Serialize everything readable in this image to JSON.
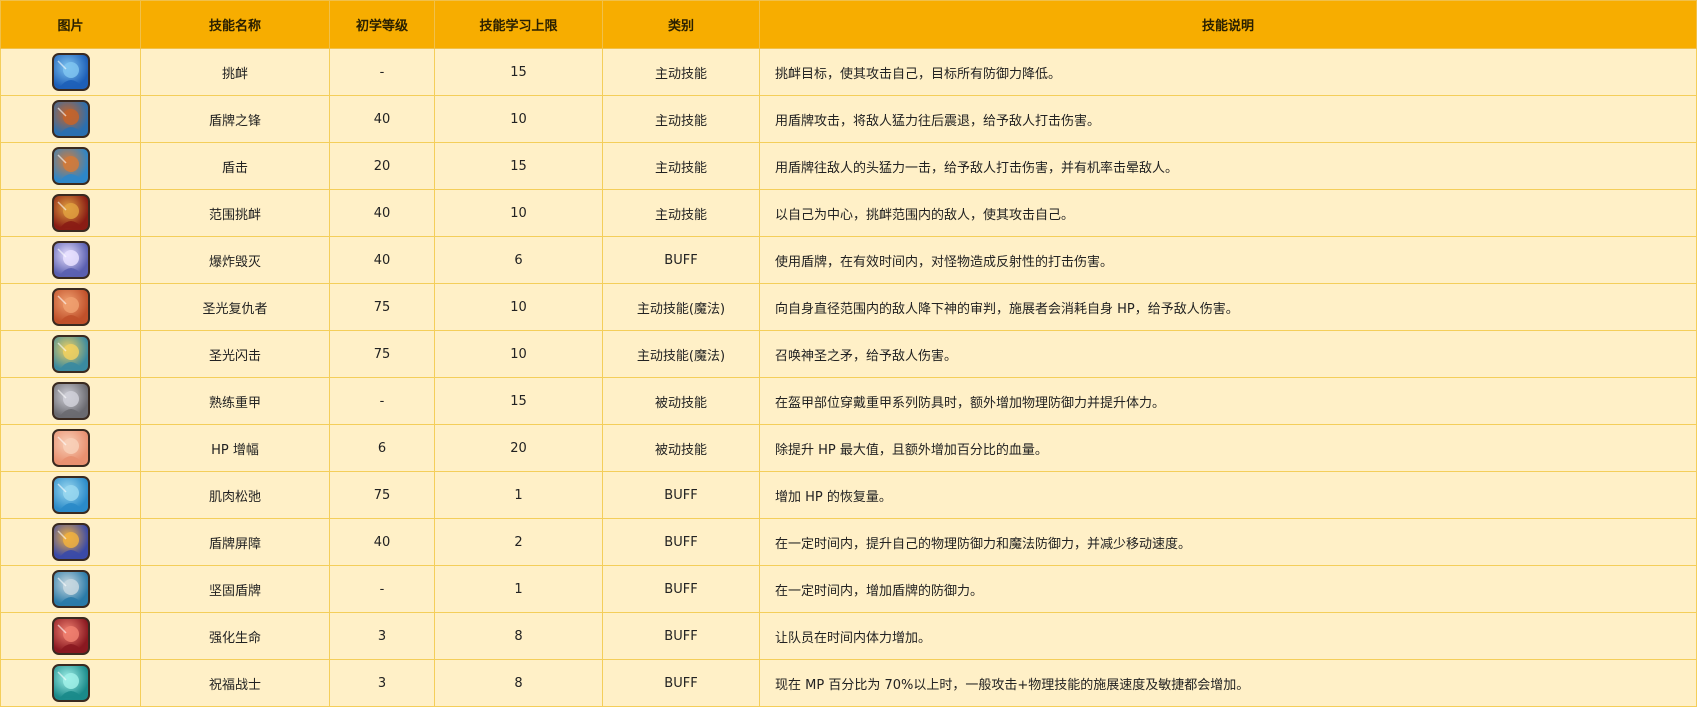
{
  "table": {
    "headers": {
      "image": "图片",
      "name": "技能名称",
      "level": "初学等级",
      "max": "技能学习上限",
      "category": "类别",
      "description": "技能说明"
    },
    "rows": [
      {
        "icon": "taunt-mask-icon",
        "colors": [
          "#1d5fb8",
          "#7fc4f0"
        ],
        "name": "挑衅",
        "level": "-",
        "max": "15",
        "category": "主动技能",
        "description": "挑衅目标，使其攻击自己，目标所有防御力降低。"
      },
      {
        "icon": "shield-edge-icon",
        "colors": [
          "#2a6fb0",
          "#c5642a"
        ],
        "name": "盾牌之锋",
        "level": "40",
        "max": "10",
        "category": "主动技能",
        "description": "用盾牌攻击，将敌人猛力往后震退，给予敌人打击伤害。"
      },
      {
        "icon": "shield-bash-icon",
        "colors": [
          "#2d86c8",
          "#d27a3a"
        ],
        "name": "盾击",
        "level": "20",
        "max": "15",
        "category": "主动技能",
        "description": "用盾牌往敌人的头猛力一击，给予敌人打击伤害，并有机率击晕敌人。"
      },
      {
        "icon": "area-taunt-icon",
        "colors": [
          "#8a1c14",
          "#e0a040"
        ],
        "name": "范围挑衅",
        "level": "40",
        "max": "10",
        "category": "主动技能",
        "description": "以自己为中心，挑衅范围内的敌人，使其攻击自己。"
      },
      {
        "icon": "explosion-shield-icon",
        "colors": [
          "#5a5fb0",
          "#e8e0ff"
        ],
        "name": "爆炸毁灭",
        "level": "40",
        "max": "6",
        "category": "BUFF",
        "description": "使用盾牌，在有效时间内，对怪物造成反射性的打击伤害。"
      },
      {
        "icon": "holy-avenger-icon",
        "colors": [
          "#c0502a",
          "#f0a070"
        ],
        "name": "圣光复仇者",
        "level": "75",
        "max": "10",
        "category": "主动技能(魔法)",
        "description": "向自身直径范围内的敌人降下神的审判，施展者会消耗自身 HP，给予敌人伤害。"
      },
      {
        "icon": "holy-flash-icon",
        "colors": [
          "#3a8aa0",
          "#f0d060"
        ],
        "name": "圣光闪击",
        "level": "75",
        "max": "10",
        "category": "主动技能(魔法)",
        "description": "召唤神圣之矛，给予敌人伤害。"
      },
      {
        "icon": "heavy-armor-icon",
        "colors": [
          "#6a6a70",
          "#d0d0d8"
        ],
        "name": "熟练重甲",
        "level": "-",
        "max": "15",
        "category": "被动技能",
        "description": "在盔甲部位穿戴重甲系列防具时，额外增加物理防御力并提升体力。"
      },
      {
        "icon": "hp-boost-icon",
        "colors": [
          "#e89070",
          "#f8d0b8"
        ],
        "name": "HP 增幅",
        "level": "6",
        "max": "20",
        "category": "被动技能",
        "description": "除提升 HP 最大值，且额外增加百分比的血量。"
      },
      {
        "icon": "muscle-relax-icon",
        "colors": [
          "#2a8ac8",
          "#9ad8f0"
        ],
        "name": "肌肉松弛",
        "level": "75",
        "max": "1",
        "category": "BUFF",
        "description": "增加 HP 的恢复量。"
      },
      {
        "icon": "shield-barrier-icon",
        "colors": [
          "#3a4aa8",
          "#f0b040"
        ],
        "name": "盾牌屏障",
        "level": "40",
        "max": "2",
        "category": "BUFF",
        "description": "在一定时间内，提升自己的物理防御力和魔法防御力，并减少移动速度。"
      },
      {
        "icon": "solid-shield-icon",
        "colors": [
          "#2a7aa8",
          "#c8d8e0"
        ],
        "name": "坚固盾牌",
        "level": "-",
        "max": "1",
        "category": "BUFF",
        "description": "在一定时间内，增加盾牌的防御力。"
      },
      {
        "icon": "life-boost-icon",
        "colors": [
          "#8a1820",
          "#f08070"
        ],
        "name": "强化生命",
        "level": "3",
        "max": "8",
        "category": "BUFF",
        "description": "让队员在时间内体力增加。"
      },
      {
        "icon": "blessed-warrior-icon",
        "colors": [
          "#1a8a8a",
          "#a0f0e8"
        ],
        "name": "祝福战士",
        "level": "3",
        "max": "8",
        "category": "BUFF",
        "description": "现在 MP 百分比为 70%以上时，一般攻击+物理技能的施展速度及敏捷都会增加。"
      }
    ]
  }
}
